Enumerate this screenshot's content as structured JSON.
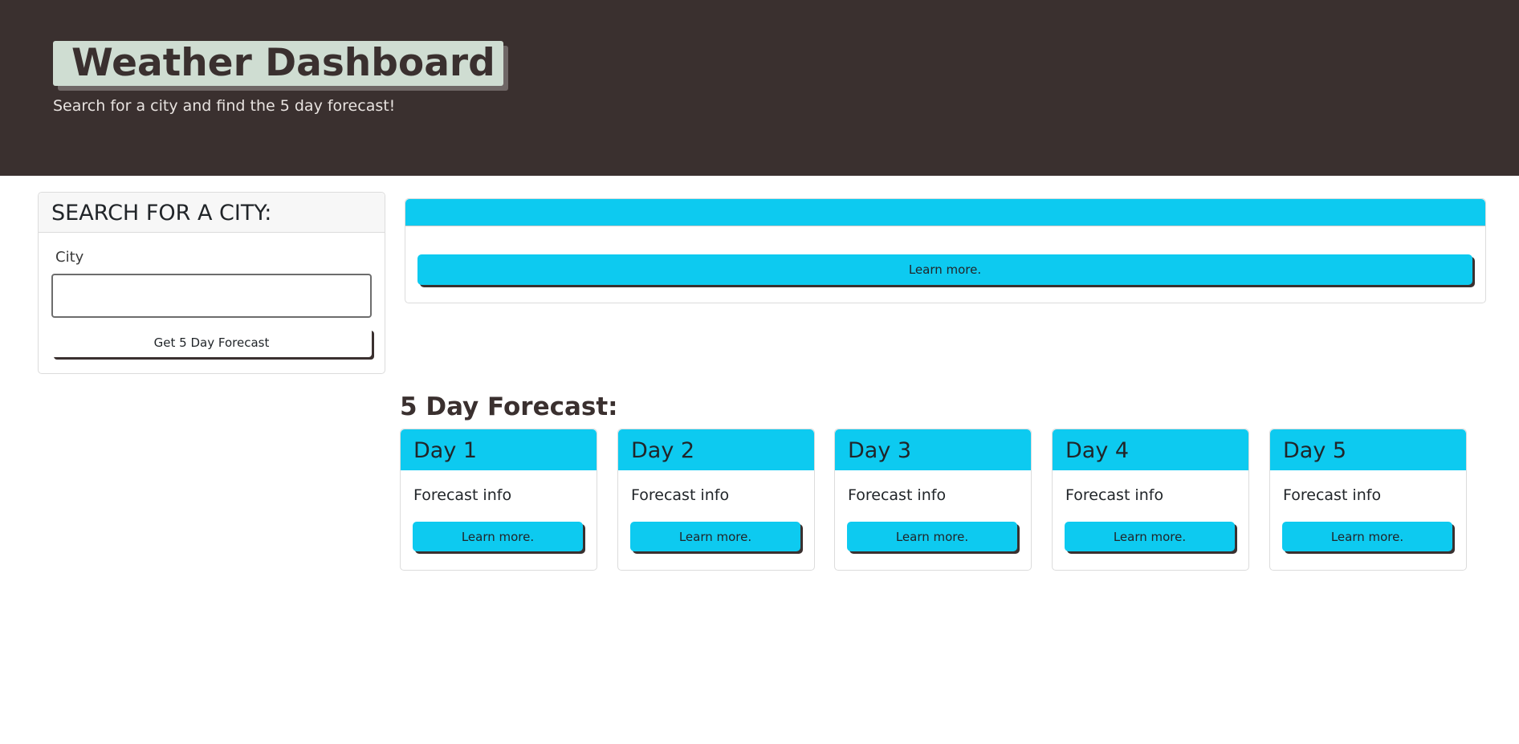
{
  "header": {
    "title": "Weather Dashboard",
    "subtitle": "Search for a city and find the 5 day forecast!"
  },
  "search": {
    "heading": "SEARCH FOR A CITY:",
    "city_label": "City",
    "city_value": "",
    "button_label": "Get 5 Day Forecast"
  },
  "current": {
    "title": "",
    "button_label": "Learn more."
  },
  "forecast": {
    "heading": "5 Day Forecast:",
    "days": [
      {
        "title": "Day 1",
        "info": "Forecast info",
        "button_label": "Learn more."
      },
      {
        "title": "Day 2",
        "info": "Forecast info",
        "button_label": "Learn more."
      },
      {
        "title": "Day 3",
        "info": "Forecast info",
        "button_label": "Learn more."
      },
      {
        "title": "Day 4",
        "info": "Forecast info",
        "button_label": "Learn more."
      },
      {
        "title": "Day 5",
        "info": "Forecast info",
        "button_label": "Learn more."
      }
    ]
  },
  "colors": {
    "header_bg": "#3a302f",
    "title_badge": "#cfddd2",
    "accent": "#0dcaf0"
  }
}
